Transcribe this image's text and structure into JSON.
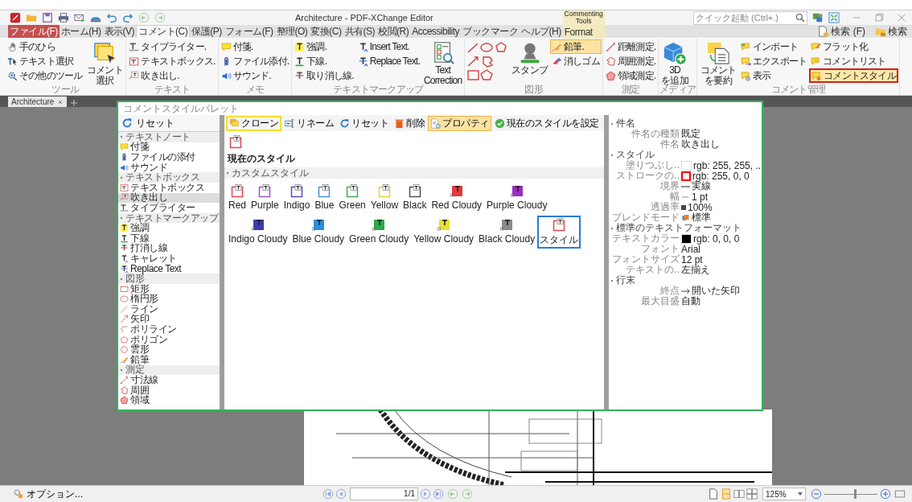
{
  "title_bar": {
    "title": "Architecture - PDF-XChange Editor",
    "context_label": "Commenting Tools",
    "search_placeholder": "クイック起動 (Ctrl+.)"
  },
  "menu_tabs": [
    {
      "label": "ファイル(F)",
      "kind": "file",
      "selected": false
    },
    {
      "label": "ホーム(H)",
      "kind": "tab",
      "selected": false
    },
    {
      "label": "表示(V)",
      "kind": "tab",
      "selected": false
    },
    {
      "label": "コメント(C)",
      "kind": "tab",
      "selected": true
    },
    {
      "label": "保護(P)",
      "kind": "tab",
      "selected": false
    },
    {
      "label": "フォーム(F)",
      "kind": "tab",
      "selected": false
    },
    {
      "label": "整理(O)",
      "kind": "tab",
      "selected": false
    },
    {
      "label": "変換(C)",
      "kind": "tab",
      "selected": false
    },
    {
      "label": "共有(S)",
      "kind": "tab",
      "selected": false
    },
    {
      "label": "校閲(R)",
      "kind": "tab",
      "selected": false
    },
    {
      "label": "Accessibility",
      "kind": "tab",
      "selected": false
    },
    {
      "label": "ブックマーク",
      "kind": "tab",
      "selected": false
    },
    {
      "label": "ヘルプ(H)",
      "kind": "tab",
      "selected": false
    },
    {
      "label": "Format",
      "kind": "context",
      "selected": false
    }
  ],
  "search_buttons": [
    "検索 (F)",
    "検索"
  ],
  "ribbon": {
    "groups": [
      {
        "label": "ツール",
        "items": [
          {
            "label": "手のひら",
            "kind": "small",
            "pressed": false,
            "outlined": false
          },
          {
            "label": "テキスト選択",
            "kind": "small",
            "pressed": false,
            "outlined": false
          },
          {
            "label": "その他のツール",
            "kind": "small",
            "pressed": false,
            "outlined": false
          },
          {
            "label": "コメント選択",
            "kind": "large",
            "pressed": false,
            "outlined": false
          }
        ]
      },
      {
        "label": "テキスト",
        "items": [
          {
            "label": "タイプライター.",
            "kind": "small",
            "pressed": false,
            "outlined": false
          },
          {
            "label": "テキストボックス.",
            "kind": "small",
            "pressed": false,
            "outlined": false
          },
          {
            "label": "吹き出し.",
            "kind": "small",
            "pressed": false,
            "outlined": false
          }
        ]
      },
      {
        "label": "メモ",
        "items": [
          {
            "label": "付箋.",
            "kind": "small",
            "pressed": false,
            "outlined": false
          },
          {
            "label": "ファイル添付.",
            "kind": "small",
            "pressed": false,
            "outlined": false
          },
          {
            "label": "サウンド.",
            "kind": "small",
            "pressed": false,
            "outlined": false
          }
        ]
      },
      {
        "label": "テキストマークアップ",
        "items": [
          {
            "label": "強調.",
            "kind": "small",
            "pressed": false,
            "outlined": false
          },
          {
            "label": "下線.",
            "kind": "small",
            "pressed": false,
            "outlined": false
          },
          {
            "label": "取り消し線.",
            "kind": "small",
            "pressed": false,
            "outlined": false
          },
          {
            "label": "Insert Text.",
            "kind": "small",
            "pressed": false,
            "outlined": false
          },
          {
            "label": "Replace Text.",
            "kind": "small",
            "pressed": false,
            "outlined": false
          },
          {
            "label": "Text\nCorrection",
            "kind": "large",
            "pressed": false,
            "outlined": false
          }
        ]
      },
      {
        "label": "図形",
        "items": [
          {
            "kind": "shapes",
            "pressed": false,
            "outlined": false
          },
          {
            "label": "スタンプ",
            "kind": "large",
            "pressed": false,
            "outlined": false
          },
          {
            "label": "鉛筆.",
            "kind": "small",
            "pressed": true,
            "outlined": false
          },
          {
            "label": "消しゴム",
            "kind": "small",
            "pressed": false,
            "outlined": false
          }
        ]
      },
      {
        "label": "測定",
        "items": [
          {
            "label": "距離測定.",
            "kind": "small",
            "pressed": false,
            "outlined": false
          },
          {
            "label": "周囲測定.",
            "kind": "small",
            "pressed": false,
            "outlined": false
          },
          {
            "label": "領域測定.",
            "kind": "small",
            "pressed": false,
            "outlined": false
          }
        ]
      },
      {
        "label": "メディア",
        "items": [
          {
            "label": "3D\nを追加",
            "kind": "large",
            "pressed": false,
            "outlined": false
          }
        ]
      },
      {
        "label": "コメント管理",
        "items": [
          {
            "label": "コメントを要約",
            "kind": "large",
            "pressed": false,
            "outlined": false
          },
          {
            "label": "インポート",
            "kind": "small",
            "pressed": false,
            "outlined": false
          },
          {
            "label": "エクスポート",
            "kind": "small",
            "pressed": false,
            "outlined": false
          },
          {
            "label": "表示",
            "kind": "small",
            "pressed": false,
            "outlined": false
          },
          {
            "label": "フラット化",
            "kind": "small",
            "pressed": false,
            "outlined": false
          },
          {
            "label": "コメントリスト",
            "kind": "small",
            "pressed": false,
            "outlined": false
          },
          {
            "label": "コメントスタイル",
            "kind": "small",
            "pressed": false,
            "outlined": true
          }
        ]
      }
    ]
  },
  "doc_tabs": [
    {
      "label": "Architecture",
      "selected": true
    }
  ],
  "dialog": {
    "title": "コメントスタイルパレット",
    "reset": "リセット",
    "tree": [
      {
        "label": "テキストノート",
        "children": [
          {
            "label": "付箋",
            "selected": false
          },
          {
            "label": "ファイルの添付",
            "selected": false
          },
          {
            "label": "サウンド",
            "selected": false
          }
        ]
      },
      {
        "label": "テキストボックス",
        "children": [
          {
            "label": "テキストボックス",
            "selected": false
          },
          {
            "label": "吹き出し",
            "selected": true
          },
          {
            "label": "タイプライター",
            "selected": false
          }
        ]
      },
      {
        "label": "テキストマークアップ",
        "children": [
          {
            "label": "強調",
            "selected": false
          },
          {
            "label": "下線",
            "selected": false
          },
          {
            "label": "打消し線",
            "selected": false
          },
          {
            "label": "キャレット",
            "selected": false
          },
          {
            "label": "Replace Text",
            "selected": false
          }
        ]
      },
      {
        "label": "図形",
        "children": [
          {
            "label": "矩形",
            "selected": false
          },
          {
            "label": "楕円形",
            "selected": false
          },
          {
            "label": "ライン",
            "selected": false
          },
          {
            "label": "矢印",
            "selected": false
          },
          {
            "label": "ポリライン",
            "selected": false
          },
          {
            "label": "ポリゴン",
            "selected": false
          },
          {
            "label": "雲形",
            "selected": false
          },
          {
            "label": "鉛筆",
            "selected": false
          }
        ]
      },
      {
        "label": "測定",
        "children": [
          {
            "label": "寸法線",
            "selected": false
          },
          {
            "label": "周囲",
            "selected": false
          },
          {
            "label": "領域",
            "selected": false
          }
        ]
      }
    ],
    "toolbar": [
      {
        "label": "クローン",
        "pressed": false,
        "outlined": true
      },
      {
        "label": "リネーム",
        "pressed": false,
        "outlined": false
      },
      {
        "label": "リセット",
        "pressed": false,
        "outlined": false
      },
      {
        "label": "削除",
        "pressed": false,
        "outlined": false
      },
      {
        "label": "プロパティ",
        "pressed": true,
        "outlined": false
      },
      {
        "label": "現在のスタイルを設定",
        "pressed": false,
        "outlined": false
      }
    ],
    "current_style": "現在のスタイル",
    "custom_section": "カスタムスタイル",
    "styles": [
      {
        "name": "Red",
        "color": "#e04848",
        "cloudy": false,
        "selected": false
      },
      {
        "name": "Purple",
        "color": "#a050c8",
        "cloudy": false,
        "selected": false
      },
      {
        "name": "Indigo",
        "color": "#5050b8",
        "cloudy": false,
        "selected": false
      },
      {
        "name": "Blue",
        "color": "#4a90e0",
        "cloudy": false,
        "selected": false
      },
      {
        "name": "Green",
        "color": "#40a850",
        "cloudy": false,
        "selected": false
      },
      {
        "name": "Yellow",
        "color": "#e0d040",
        "cloudy": false,
        "selected": false
      },
      {
        "name": "Black",
        "color": "#505050",
        "cloudy": false,
        "selected": false
      },
      {
        "name": "Red Cloudy",
        "color": "#e03a3a",
        "cloudy": true,
        "selected": false
      },
      {
        "name": "Purple Cloudy",
        "color": "#9a2cc0",
        "cloudy": true,
        "selected": false
      },
      {
        "name": "Indigo Cloudy",
        "color": "#3b3bb0",
        "cloudy": true,
        "selected": false
      },
      {
        "name": "Blue Cloudy",
        "color": "#2a8ee0",
        "cloudy": true,
        "selected": false
      },
      {
        "name": "Green Cloudy",
        "color": "#2fa84a",
        "cloudy": true,
        "selected": false
      },
      {
        "name": "Yellow Cloudy",
        "color": "#e8e030",
        "cloudy": true,
        "selected": false
      },
      {
        "name": "Black Cloudy",
        "color": "#8a8a8a",
        "cloudy": true,
        "selected": false
      },
      {
        "name": "スタイル",
        "color": "#e04848",
        "cloudy": false,
        "selected": true
      }
    ],
    "properties": [
      {
        "label": "件名",
        "rows": [
          {
            "name": "件名の種類",
            "value": "既定",
            "kind": "text"
          },
          {
            "name": "件名",
            "value": "吹き出し",
            "kind": "text"
          }
        ]
      },
      {
        "label": "スタイル",
        "rows": [
          {
            "name": "塗りつぶし..",
            "value": "rgb: 255, 255, ..",
            "kind": "swatch",
            "color": "#ffffff"
          },
          {
            "name": "ストロークの..",
            "value": "rgb: 255, 0, 0",
            "kind": "outline",
            "color": "#ff0000"
          },
          {
            "name": "境界",
            "value": "実線",
            "kind": "line"
          },
          {
            "name": "幅",
            "value": "1 pt",
            "kind": "dash"
          },
          {
            "name": "透過率",
            "value": "100%",
            "kind": "square"
          },
          {
            "name": "ブレンドモード",
            "value": "標準",
            "kind": "blend"
          }
        ]
      },
      {
        "label": "標準のテキストフォーマット",
        "rows": [
          {
            "name": "テキストカラー",
            "value": "rgb: 0, 0, 0",
            "kind": "swatch",
            "color": "#000000"
          },
          {
            "name": "フォント",
            "value": "Arial",
            "kind": "text"
          },
          {
            "name": "フォントサイズ",
            "value": "12 pt",
            "kind": "text"
          },
          {
            "name": "テキストの..",
            "value": "左揃え",
            "kind": "text"
          }
        ]
      },
      {
        "label": "行末",
        "rows": [
          {
            "name": "終点",
            "value": "開いた矢印",
            "kind": "arrow"
          },
          {
            "name": "最大目盛",
            "value": "自動",
            "kind": "text"
          }
        ]
      }
    ]
  },
  "status_bar": {
    "options": "オプション...",
    "page": "1/1",
    "zoom": "125%",
    "zoom_slider": {
      "level": 0.57
    }
  }
}
